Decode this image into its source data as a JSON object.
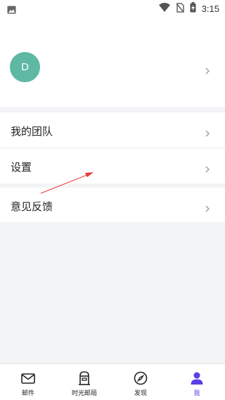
{
  "status_bar": {
    "time": "3:15"
  },
  "profile": {
    "avatar_letter": "D"
  },
  "menu": {
    "items": [
      {
        "label": "我的团队"
      },
      {
        "label": "设置"
      },
      {
        "label": "意见反馈"
      }
    ]
  },
  "tabbar": {
    "tabs": [
      {
        "label": "邮件",
        "icon": "mail-icon"
      },
      {
        "label": "时光邮局",
        "icon": "mailbox-icon"
      },
      {
        "label": "发现",
        "icon": "compass-icon"
      },
      {
        "label": "我",
        "icon": "person-icon"
      }
    ],
    "active_color": "#5b3ee6"
  },
  "colors": {
    "avatar": "#5fb8a3",
    "background": "#f3f4f6",
    "annotation_arrow": "#e53935"
  }
}
